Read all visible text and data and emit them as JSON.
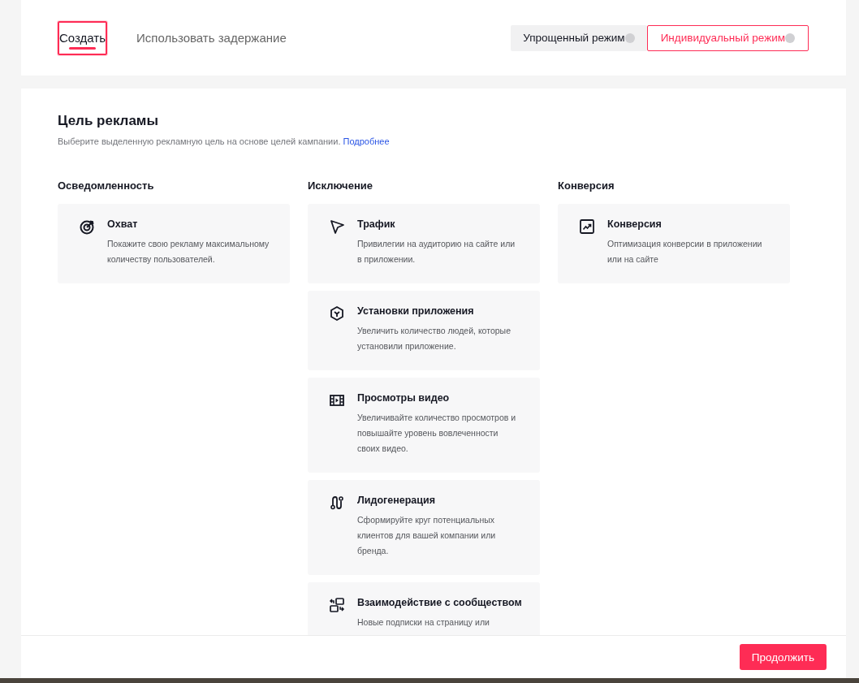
{
  "tabs": [
    {
      "label": "Создать",
      "selected": true
    },
    {
      "label": "Использовать задержание",
      "selected": false
    }
  ],
  "modes": [
    {
      "label": "Упрощенный режим",
      "selected": false
    },
    {
      "label": "Индивидуальный режим",
      "selected": true
    }
  ],
  "objective": {
    "title": "Цель рекламы",
    "subtitle": "Выберите выделенную рекламную цель на основе целей кампании.",
    "link": "Подробнее"
  },
  "columns": [
    {
      "heading": "Осведомленность",
      "options": [
        {
          "kind": "reach",
          "title": "Охват",
          "description": "Покажите свою рекламу максимальному количеству пользователей."
        }
      ]
    },
    {
      "heading": "Исключение",
      "options": [
        {
          "kind": "traffic",
          "title": "Трафик",
          "description": "Привилегии на аудиторию на сайте или в приложении."
        },
        {
          "kind": "install",
          "title": "Установки приложения",
          "description": "Увеличить количество людей, которые установили приложение."
        },
        {
          "kind": "video",
          "title": "Просмотры видео",
          "description": "Увеличивайте количество просмотров и повышайте уровень вовлеченности своих видео."
        },
        {
          "kind": "leads",
          "title": "Лидогенерация",
          "description": "Сформируйте круг потенциальных клиентов для вашей компании или бренда."
        },
        {
          "kind": "community",
          "title": "Взаимодействие с сообществом",
          "description": "Новые подписки на страницу или"
        }
      ]
    },
    {
      "heading": "Конверсия",
      "options": [
        {
          "kind": "conversion",
          "title": "Конверсия",
          "description": "Оптимизация конверсии в приложении или на сайте"
        }
      ]
    }
  ],
  "footer": {
    "button": "Продолжить"
  }
}
